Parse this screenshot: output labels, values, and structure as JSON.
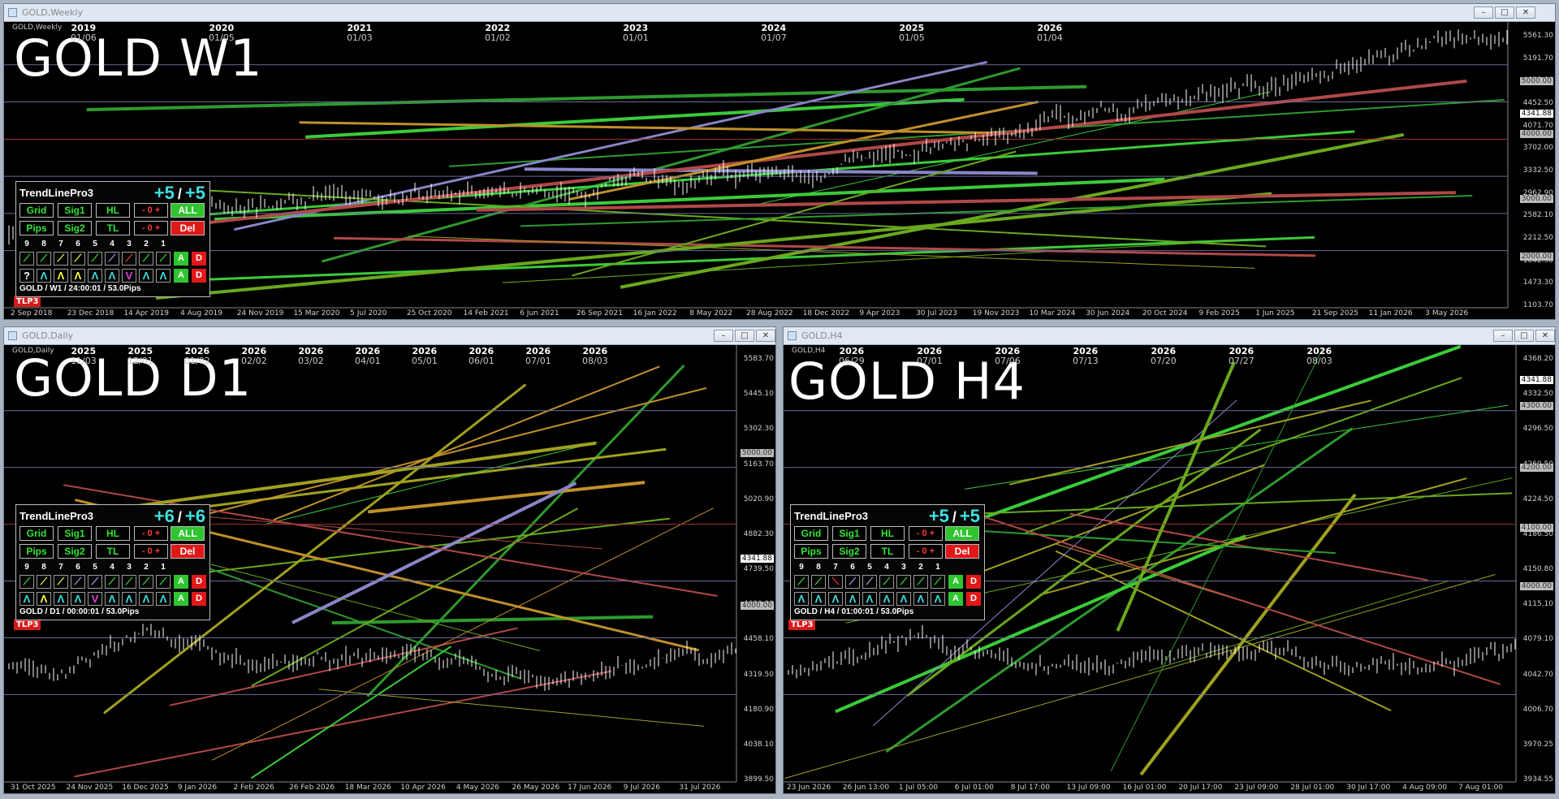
{
  "windows": {
    "weekly": {
      "title": "GOLD,Weekly",
      "symbol_label": "GOLD,Weekly",
      "big_title": "GOLD W1",
      "price_labels": [
        "5561.30",
        "5191.70",
        "4822.10",
        "4452.50",
        "4071.70",
        "3702.00",
        "3332.50",
        "2962.90",
        "2582.10",
        "2212.50",
        "1842.90",
        "1473.30",
        "1103.70"
      ],
      "price_tags": [
        {
          "text": "5000.00",
          "color": "#bbbbbb"
        },
        {
          "text": "4341.88",
          "color": "#ffffff"
        },
        {
          "text": "4000.00",
          "color": "#bbbbbb"
        },
        {
          "text": "3000.00",
          "color": "#bbbbbb"
        },
        {
          "text": "2000.00",
          "color": "#bbbbbb"
        }
      ],
      "date_labels": [
        "2 Sep 2018",
        "23 Dec 2018",
        "14 Apr 2019",
        "4 Aug 2019",
        "24 Nov 2019",
        "15 Mar 2020",
        "5 Jul 2020",
        "25 Oct 2020",
        "14 Feb 2021",
        "6 Jun 2021",
        "26 Sep 2021",
        "16 Jan 2022",
        "8 May 2022",
        "28 Aug 2022",
        "18 Dec 2022",
        "9 Apr 2023",
        "30 Jul 2023",
        "19 Nov 2023",
        "10 Mar 2024",
        "30 Jun 2024",
        "20 Oct 2024",
        "9 Feb 2025",
        "1 Jun 2025",
        "21 Sep 2025",
        "11 Jan 2026",
        "3 May 2026"
      ],
      "separators": [
        {
          "year": "2019",
          "date": "01/06"
        },
        {
          "year": "2020",
          "date": "01/05"
        },
        {
          "year": "2021",
          "date": "01/03"
        },
        {
          "year": "2022",
          "date": "01/02"
        },
        {
          "year": "2023",
          "date": "01/01"
        },
        {
          "year": "2024",
          "date": "01/07"
        },
        {
          "year": "2025",
          "date": "01/05"
        },
        {
          "year": "2026",
          "date": "01/04"
        }
      ],
      "tlp3": "TLP3",
      "panel": {
        "name": "TrendLinePro3",
        "count_left": "+5",
        "count_right": "+5",
        "slash": "/",
        "row1": [
          "Grid",
          "Sig1",
          "HL",
          "- 0 +",
          "ALL"
        ],
        "row2": [
          "Pips",
          "Sig2",
          "TL",
          "- 0 +",
          "Del"
        ],
        "numbers": [
          "9",
          "8",
          "7",
          "6",
          "5",
          "4",
          "3",
          "2",
          "1"
        ],
        "row3": [
          {
            "t": "⟋",
            "c": "#33e633"
          },
          {
            "t": "⟋",
            "c": "#33e633"
          },
          {
            "t": "⟋",
            "c": "#ffff40"
          },
          {
            "t": "⟋",
            "c": "#ffff40"
          },
          {
            "t": "⟋",
            "c": "#33e633"
          },
          {
            "t": "⟋",
            "c": "#b99cff"
          },
          {
            "t": "⟋",
            "c": "#ff3a3a"
          },
          {
            "t": "⟋",
            "c": "#33e633"
          },
          {
            "t": "⟋",
            "c": "#33e633"
          }
        ],
        "row4": [
          {
            "t": "?",
            "c": "#ffffff"
          },
          {
            "t": "Λ",
            "c": "#3ee0e0"
          },
          {
            "t": "Λ",
            "c": "#ffff40"
          },
          {
            "t": "Λ",
            "c": "#ffff40"
          },
          {
            "t": "Λ",
            "c": "#3ee0e0"
          },
          {
            "t": "Λ",
            "c": "#3ee0e0"
          },
          {
            "t": "V",
            "c": "#e040e0"
          },
          {
            "t": "Λ",
            "c": "#3ee0e0"
          },
          {
            "t": "Λ",
            "c": "#3ee0e0"
          }
        ],
        "a_label": "A",
        "d_label": "D",
        "footer": "GOLD / W1 / 24:00:01 / 53.0Pips"
      }
    },
    "daily": {
      "title": "GOLD,Daily",
      "symbol_label": "GOLD,Daily",
      "big_title": "GOLD D1",
      "price_labels": [
        "5583.70",
        "5445.10",
        "5302.30",
        "5163.70",
        "5020.90",
        "4882.30",
        "4739.50",
        "4600.90",
        "4458.10",
        "4319.50",
        "4180.90",
        "4038.10",
        "3899.50"
      ],
      "price_tags": [
        {
          "text": "5000.00",
          "color": "#bbbbbb"
        },
        {
          "text": "4341.88",
          "color": "#ffffff"
        },
        {
          "text": "4000.00",
          "color": "#bbbbbb"
        }
      ],
      "date_labels": [
        "31 Oct 2025",
        "24 Nov 2025",
        "16 Dec 2025",
        "9 Jan 2026",
        "2 Feb 2026",
        "26 Feb 2026",
        "18 Mar 2026",
        "10 Apr 2026",
        "4 May 2026",
        "26 May 2026",
        "17 Jun 2026",
        "9 Jul 2026",
        "31 Jul 2026"
      ],
      "separators": [
        {
          "year": "2025",
          "date": "11/03"
        },
        {
          "year": "2025",
          "date": "12/01"
        },
        {
          "year": "2026",
          "date": "01/02"
        },
        {
          "year": "2026",
          "date": "02/02"
        },
        {
          "year": "2026",
          "date": "03/02"
        },
        {
          "year": "2026",
          "date": "04/01"
        },
        {
          "year": "2026",
          "date": "05/01"
        },
        {
          "year": "2026",
          "date": "06/01"
        },
        {
          "year": "2026",
          "date": "07/01"
        },
        {
          "year": "2026",
          "date": "08/03"
        }
      ],
      "tlp3": "TLP3",
      "panel": {
        "name": "TrendLinePro3",
        "count_left": "+6",
        "count_right": "+6",
        "slash": "/",
        "row1": [
          "Grid",
          "Sig1",
          "HL",
          "- 0 +",
          "ALL"
        ],
        "row2": [
          "Pips",
          "Sig2",
          "TL",
          "- 0 +",
          "Del"
        ],
        "numbers": [
          "9",
          "8",
          "7",
          "6",
          "5",
          "4",
          "3",
          "2",
          "1"
        ],
        "row3": [
          {
            "t": "⟋",
            "c": "#33e633"
          },
          {
            "t": "⟋",
            "c": "#ffff40"
          },
          {
            "t": "⟋",
            "c": "#ffff40"
          },
          {
            "t": "⟋",
            "c": "#b99cff"
          },
          {
            "t": "⟋",
            "c": "#b99cff"
          },
          {
            "t": "⟋",
            "c": "#33e633"
          },
          {
            "t": "⟋",
            "c": "#33e633"
          },
          {
            "t": "⟋",
            "c": "#33e633"
          },
          {
            "t": "⟋",
            "c": "#33e633"
          }
        ],
        "row4": [
          {
            "t": "Λ",
            "c": "#3ee0e0"
          },
          {
            "t": "Λ",
            "c": "#ffff40"
          },
          {
            "t": "Λ",
            "c": "#3ee0e0"
          },
          {
            "t": "Λ",
            "c": "#3ee0e0"
          },
          {
            "t": "V",
            "c": "#e040e0"
          },
          {
            "t": "Λ",
            "c": "#3ee0e0"
          },
          {
            "t": "Λ",
            "c": "#3ee0e0"
          },
          {
            "t": "Λ",
            "c": "#3ee0e0"
          },
          {
            "t": "Λ",
            "c": "#3ee0e0"
          }
        ],
        "a_label": "A",
        "d_label": "D",
        "footer": "GOLD / D1 / 00:00:01 / 53.0Pips"
      }
    },
    "h4": {
      "title": "GOLD,H4",
      "symbol_label": "GOLD,H4",
      "big_title": "GOLD H4",
      "price_labels": [
        "4368.20",
        "4332.50",
        "4296.50",
        "4260.50",
        "4224.50",
        "4186.50",
        "4150.80",
        "4115.10",
        "4079.10",
        "4042.70",
        "4006.70",
        "3970.25",
        "3934.55"
      ],
      "price_tags": [
        {
          "text": "4341.88",
          "color": "#ffffff"
        },
        {
          "text": "4300.00",
          "color": "#bbbbbb"
        },
        {
          "text": "4200.00",
          "color": "#bbbbbb"
        },
        {
          "text": "4100.00",
          "color": "#bbbbbb"
        },
        {
          "text": "4000.00",
          "color": "#bbbbbb"
        }
      ],
      "date_labels": [
        "23 Jun 2026",
        "26 Jun 13:00",
        "1 Jul 05:00",
        "6 Jul 01:00",
        "8 Jul 17:00",
        "13 Jul 09:00",
        "16 Jul 01:00",
        "20 Jul 17:00",
        "23 Jul 09:00",
        "28 Jul 01:00",
        "30 Jul 17:00",
        "4 Aug 09:00",
        "7 Aug 01:00"
      ],
      "separators": [
        {
          "year": "2026",
          "date": "06/29"
        },
        {
          "year": "2026",
          "date": "07/01"
        },
        {
          "year": "2026",
          "date": "07/06"
        },
        {
          "year": "2026",
          "date": "07/13"
        },
        {
          "year": "2026",
          "date": "07/20"
        },
        {
          "year": "2026",
          "date": "07/27"
        },
        {
          "year": "2026",
          "date": "08/03"
        }
      ],
      "tlp3": "TLP3",
      "panel": {
        "name": "TrendLinePro3",
        "count_left": "+5",
        "count_right": "+5",
        "slash": "/",
        "row1": [
          "Grid",
          "Sig1",
          "HL",
          "- 0 +",
          "ALL"
        ],
        "row2": [
          "Pips",
          "Sig2",
          "TL",
          "- 0 +",
          "Del"
        ],
        "numbers": [
          "9",
          "8",
          "7",
          "6",
          "5",
          "4",
          "3",
          "2",
          "1"
        ],
        "row3": [
          {
            "t": "⟋",
            "c": "#33e633"
          },
          {
            "t": "⟋",
            "c": "#33e633"
          },
          {
            "t": "⟍",
            "c": "#ff3a3a"
          },
          {
            "t": "⟋",
            "c": "#b99cff"
          },
          {
            "t": "⟋",
            "c": "#b99cff"
          },
          {
            "t": "⟋",
            "c": "#33e633"
          },
          {
            "t": "⟋",
            "c": "#33e633"
          },
          {
            "t": "⟋",
            "c": "#33e633"
          },
          {
            "t": "⟋",
            "c": "#33e633"
          }
        ],
        "row4": [
          {
            "t": "Λ",
            "c": "#3ee0e0"
          },
          {
            "t": "Λ",
            "c": "#3ee0e0"
          },
          {
            "t": "Λ",
            "c": "#3ee0e0"
          },
          {
            "t": "Λ",
            "c": "#3ee0e0"
          },
          {
            "t": "Λ",
            "c": "#3ee0e0"
          },
          {
            "t": "Λ",
            "c": "#3ee0e0"
          },
          {
            "t": "Λ",
            "c": "#3ee0e0"
          },
          {
            "t": "Λ",
            "c": "#3ee0e0"
          },
          {
            "t": "Λ",
            "c": "#3ee0e0"
          }
        ],
        "a_label": "A",
        "d_label": "D",
        "footer": "GOLD / H4 / 01:00:01 / 53.0Pips"
      }
    }
  },
  "window_buttons": {
    "minimize": "–",
    "maximize": "□",
    "close": "✕"
  }
}
